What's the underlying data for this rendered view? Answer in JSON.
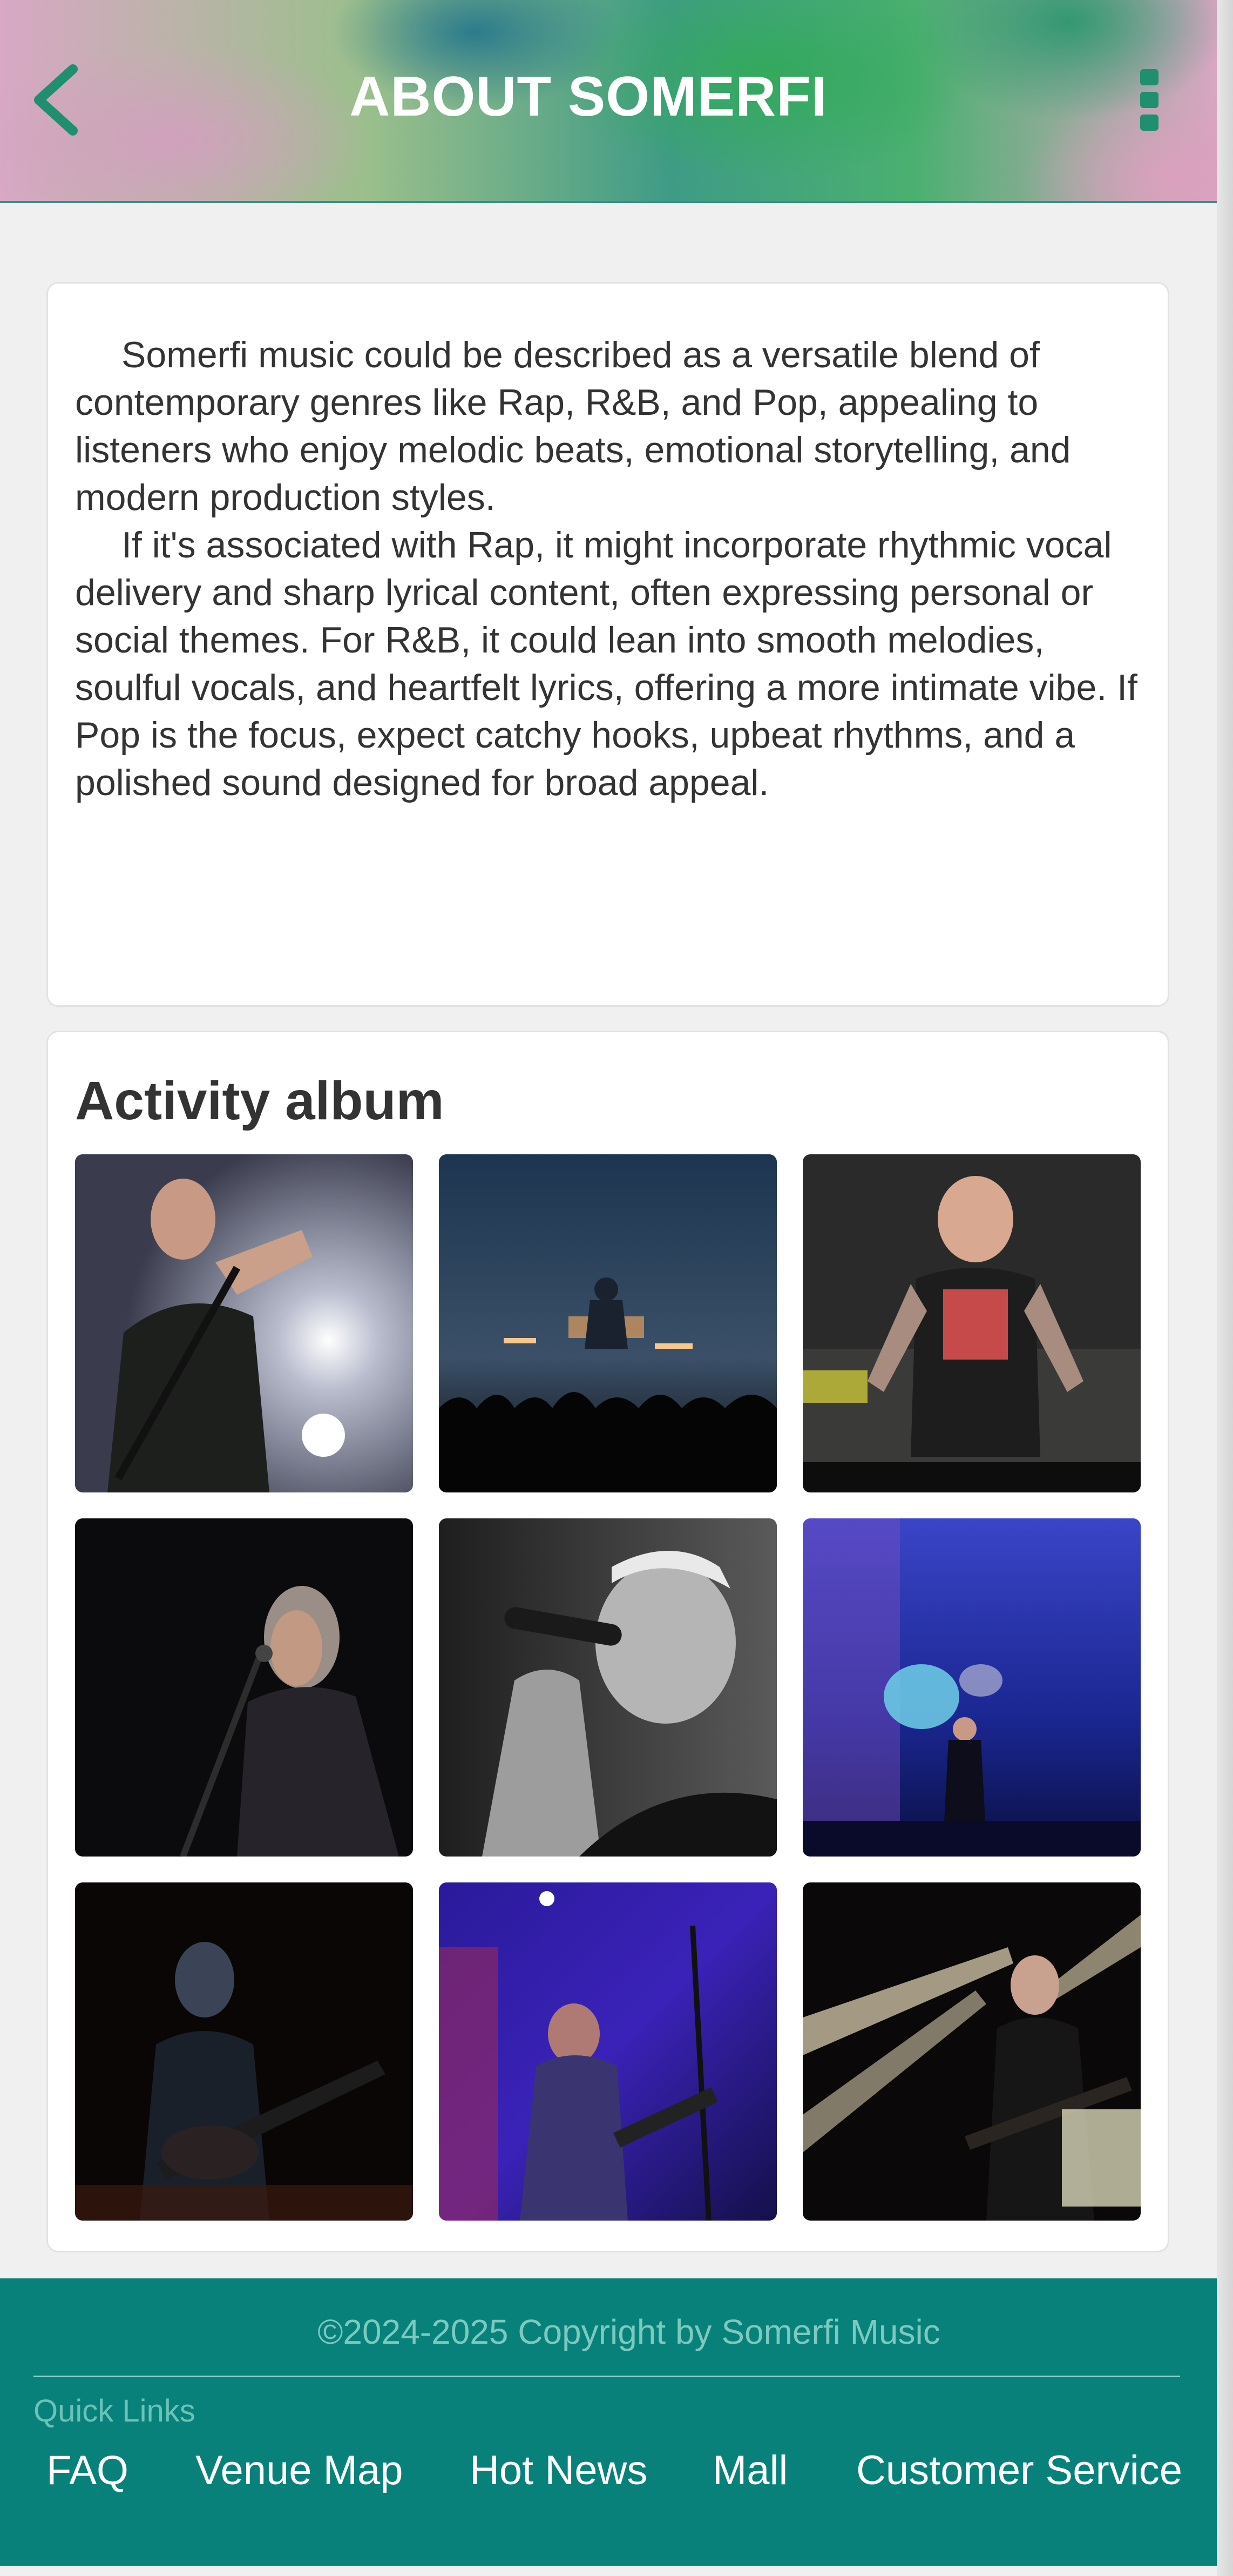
{
  "header": {
    "title": "ABOUT SOMERFI",
    "back_icon": "chevron-left-icon",
    "menu_icon": "vertical-dots-icon",
    "accent_color": "#1f8f6f"
  },
  "about": {
    "paragraphs": [
      "Somerfi music could be described as a versatile blend of contemporary genres like Rap, R&B, and Pop, appealing to listeners who enjoy melodic beats, emotional storytelling, and modern production styles.",
      "If it's associated with Rap, it might incorporate rhythmic vocal delivery and sharp lyrical content, often expressing personal or social themes. For R&B, it could lean into smooth melodies, soulful vocals, and heartfelt lyrics, offering a more intimate vibe. If Pop is the focus, expect catchy hooks, upbeat rhythms, and a polished sound designed for broad appeal."
    ]
  },
  "album": {
    "title": "Activity album",
    "photos": [
      "singer-screaming-into-mic-photo",
      "crowd-silhouette-concert-photo",
      "tattooed-performer-on-stage-photo",
      "grey-haired-singer-photo",
      "black-and-white-singer-photo",
      "drummer-blue-stage-photo",
      "bass-player-dark-stage-photo",
      "guitarist-purple-lights-photo",
      "guitarist-spotlights-photo"
    ]
  },
  "footer": {
    "copyright": "©2024-2025 Copyright by Somerfi Music",
    "quick_links_label": "Quick Links",
    "links": [
      "FAQ",
      "Venue Map",
      "Hot News",
      "Mall",
      "Customer Service"
    ],
    "background_color": "#08817b"
  }
}
